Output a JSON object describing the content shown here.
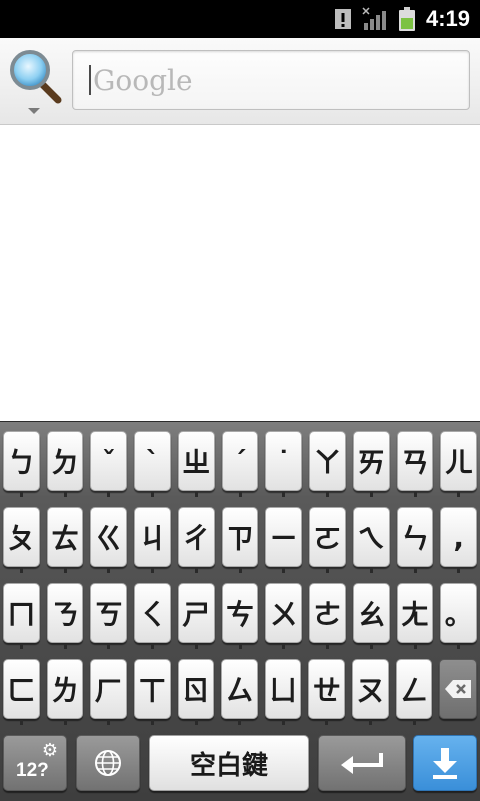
{
  "status_bar": {
    "time": "4:19",
    "icons": [
      "alert-icon",
      "signal-icon",
      "battery-icon"
    ]
  },
  "search": {
    "placeholder": "Google",
    "engine_icon": "magnifier-icon"
  },
  "keyboard": {
    "rows": [
      [
        "ㄅ",
        "ㄉ",
        "ˇ",
        "ˋ",
        "ㄓ",
        "ˊ",
        "˙",
        "ㄚ",
        "ㄞ",
        "ㄢ",
        "ㄦ"
      ],
      [
        "ㄆ",
        "ㄊ",
        "ㄍ",
        "ㄐ",
        "ㄔ",
        "ㄗ",
        "ㄧ",
        "ㄛ",
        "ㄟ",
        "ㄣ",
        ","
      ],
      [
        "ㄇ",
        "ㄋ",
        "ㄎ",
        "ㄑ",
        "ㄕ",
        "ㄘ",
        "ㄨ",
        "ㄜ",
        "ㄠ",
        "ㄤ",
        "。"
      ],
      [
        "ㄈ",
        "ㄌ",
        "ㄏ",
        "ㄒ",
        "ㄖ",
        "ㄙ",
        "ㄩ",
        "ㄝ",
        "ㄡ",
        "ㄥ"
      ]
    ],
    "mode_key_label": "12?",
    "space_label": "空白鍵",
    "accent_color": "#3a8fd9"
  }
}
